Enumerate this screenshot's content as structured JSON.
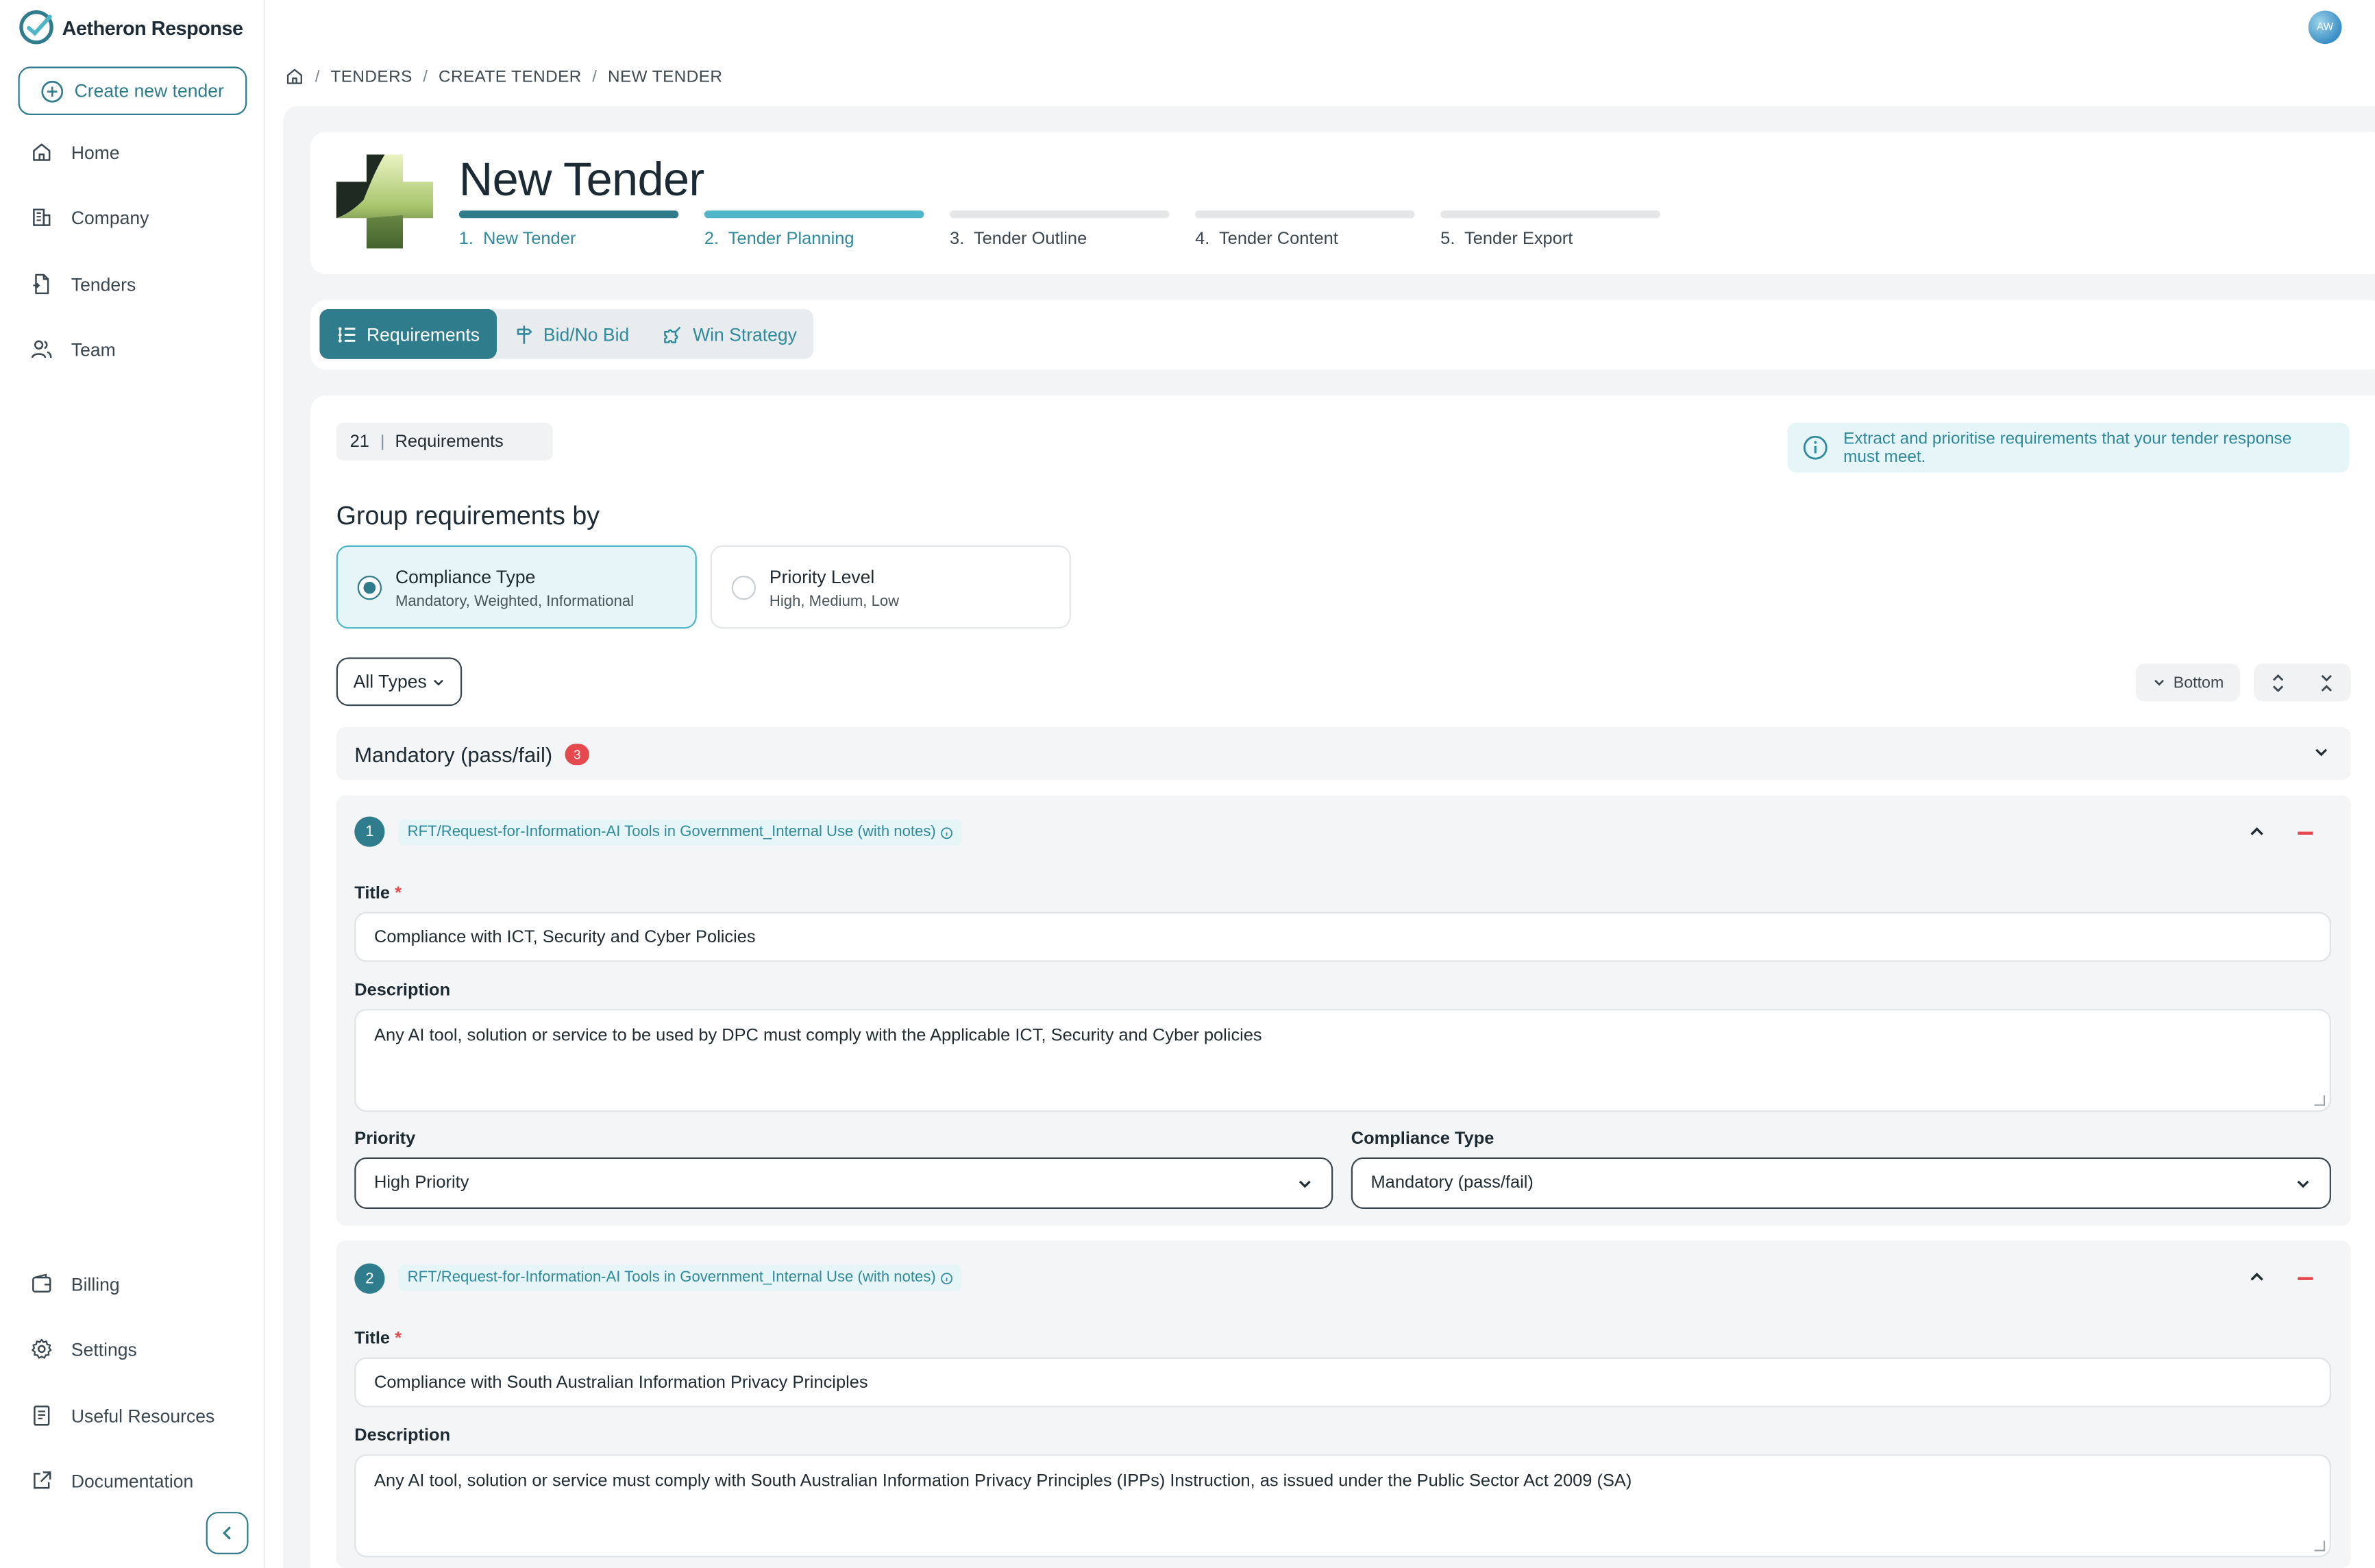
{
  "app": {
    "name": "Aetheron Response",
    "avatar_initials": "AW",
    "accent_color": "#2f7c8c",
    "accent_light": "#4fb6c9"
  },
  "sidebar": {
    "create_label": "Create new tender",
    "items": [
      {
        "label": "Home",
        "icon": "home-icon"
      },
      {
        "label": "Company",
        "icon": "building-icon"
      },
      {
        "label": "Tenders",
        "icon": "document-icon"
      },
      {
        "label": "Team",
        "icon": "users-icon"
      }
    ],
    "bottom_items": [
      {
        "label": "Billing",
        "icon": "wallet-icon"
      },
      {
        "label": "Settings",
        "icon": "gear-icon"
      },
      {
        "label": "Useful Resources",
        "icon": "book-icon"
      },
      {
        "label": "Documentation",
        "icon": "external-link-icon"
      }
    ]
  },
  "breadcrumb": [
    "TENDERS",
    "CREATE TENDER",
    "NEW TENDER"
  ],
  "header": {
    "title": "New Tender",
    "steps": [
      {
        "num": "1.",
        "label": "New Tender",
        "state": "done"
      },
      {
        "num": "2.",
        "label": "Tender Planning",
        "state": "active"
      },
      {
        "num": "3.",
        "label": "Tender Outline",
        "state": "todo"
      },
      {
        "num": "4.",
        "label": "Tender Content",
        "state": "todo"
      },
      {
        "num": "5.",
        "label": "Tender Export",
        "state": "todo"
      }
    ]
  },
  "tabs": [
    {
      "label": "Requirements",
      "icon": "list-icon",
      "active": true
    },
    {
      "label": "Bid/No Bid",
      "icon": "signpost-icon",
      "active": false
    },
    {
      "label": "Win Strategy",
      "icon": "puzzle-icon",
      "active": false
    }
  ],
  "requirements": {
    "count": "21",
    "count_label": "Requirements",
    "info": "Extract and prioritise requirements that your tender response must meet.",
    "group_title": "Group requirements by",
    "options": [
      {
        "title": "Compliance Type",
        "subtitle": "Mandatory, Weighted, Informational",
        "selected": true
      },
      {
        "title": "Priority Level",
        "subtitle": "High, Medium, Low",
        "selected": false
      }
    ],
    "filter_label": "All Types",
    "bottom_label": "Bottom",
    "group": {
      "name": "Mandatory (pass/fail)",
      "count": "3"
    },
    "labels": {
      "title": "Title",
      "required_mark": "*",
      "description": "Description",
      "priority": "Priority",
      "compliance_type": "Compliance Type"
    },
    "items": [
      {
        "num": "1",
        "source": "RFT/Request-for-Information-AI Tools in Government_Internal Use (with notes)",
        "title": "Compliance with ICT, Security and Cyber Policies",
        "description": "Any AI tool, solution or service to be used by DPC must comply with the Applicable ICT, Security and Cyber policies",
        "priority": "High Priority",
        "compliance": "Mandatory (pass/fail)"
      },
      {
        "num": "2",
        "source": "RFT/Request-for-Information-AI Tools in Government_Internal Use (with notes)",
        "title": "Compliance with South Australian Information Privacy Principles",
        "description": "Any AI tool, solution or service must comply with South Australian Information Privacy Principles (IPPs) Instruction, as issued under the Public Sector Act 2009 (SA)"
      }
    ]
  }
}
